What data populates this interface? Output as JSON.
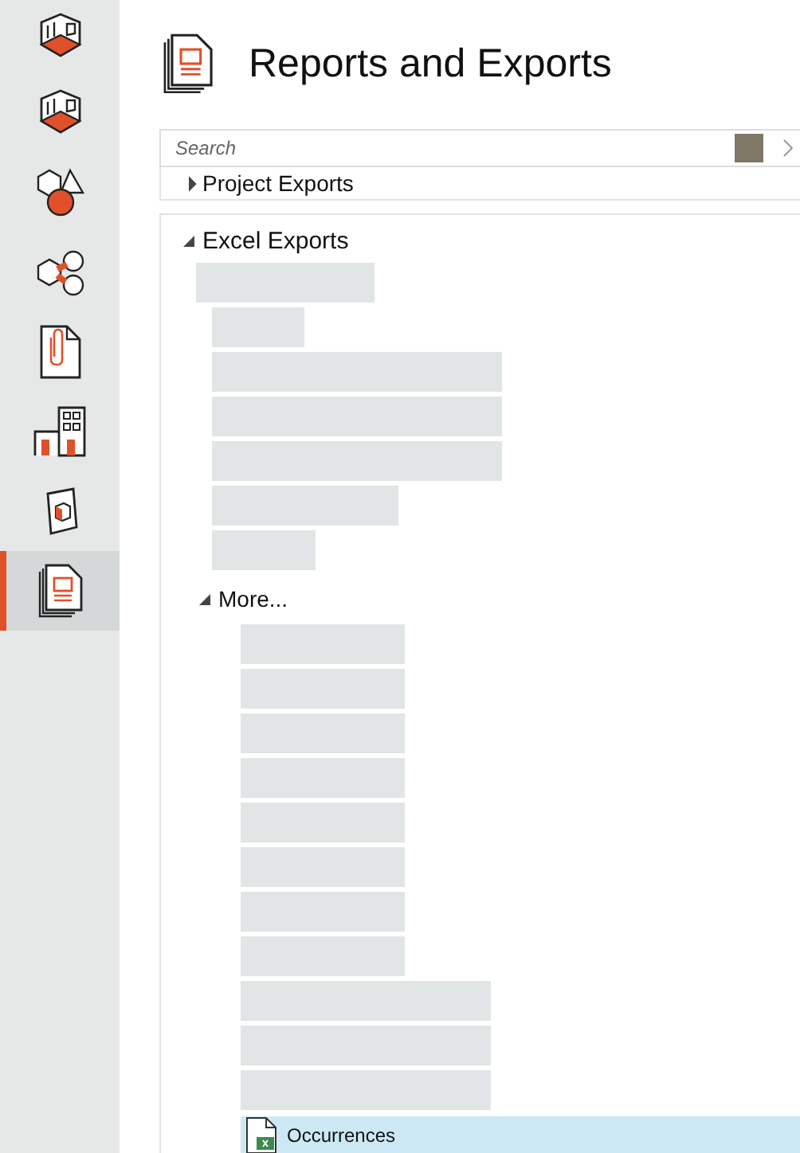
{
  "nav": [
    {
      "selected": false
    },
    {
      "selected": false
    },
    {
      "selected": false
    },
    {
      "selected": false
    },
    {
      "selected": false
    },
    {
      "selected": false
    },
    {
      "selected": false
    },
    {
      "selected": true
    }
  ],
  "header": {
    "title": "Reports and Exports"
  },
  "search": {
    "placeholder": "Search"
  },
  "sections": [
    {
      "label": "Project Exports",
      "expanded": false
    },
    {
      "label": "Excel Exports",
      "expanded": true,
      "children": [
        {
          "label": "More...",
          "expanded": true,
          "children": [
            {
              "label": "Occurrences",
              "selected": true
            }
          ]
        }
      ]
    }
  ]
}
